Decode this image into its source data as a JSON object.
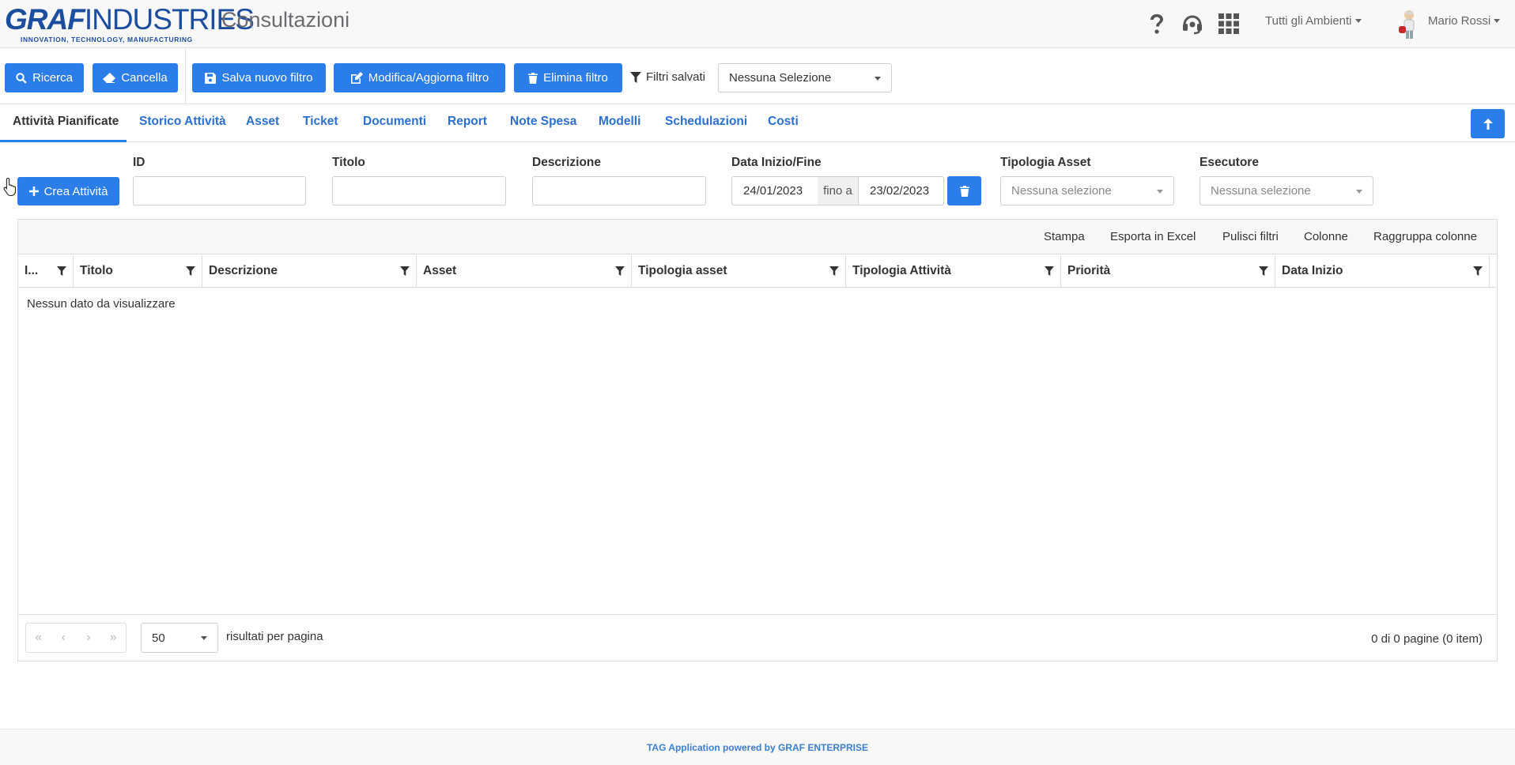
{
  "header": {
    "logo_bold": "GRAF",
    "logo_light": "INDUSTRIES",
    "logo_tagline": "INNOVATION, TECHNOLOGY, MANUFACTURING",
    "title": "Consultazioni",
    "environments_label": "Tutti gli Ambienti",
    "user_name": "Mario Rossi"
  },
  "toolbar": {
    "search_label": "Ricerca",
    "clear_label": "Cancella",
    "save_filter_label": "Salva nuovo filtro",
    "edit_filter_label": "Modifica/Aggiorna filtro",
    "delete_filter_label": "Elimina filtro",
    "saved_filters_label": "Filtri salvati",
    "saved_filters_value": "Nessuna Selezione"
  },
  "tabs": [
    {
      "label": "Attività Pianificate",
      "active": true
    },
    {
      "label": "Storico Attività"
    },
    {
      "label": "Asset"
    },
    {
      "label": "Ticket"
    },
    {
      "label": "Documenti"
    },
    {
      "label": "Report"
    },
    {
      "label": "Note Spesa"
    },
    {
      "label": "Modelli"
    },
    {
      "label": "Schedulazioni"
    },
    {
      "label": "Costi"
    }
  ],
  "filters": {
    "create_label": "Crea Attività",
    "id_label": "ID",
    "title_label": "Titolo",
    "description_label": "Descrizione",
    "date_label": "Data Inizio/Fine",
    "date_from": "24/01/2023",
    "date_sep": "fino a",
    "date_to": "23/02/2023",
    "asset_type_label": "Tipologia Asset",
    "asset_type_value": "Nessuna selezione",
    "executor_label": "Esecutore",
    "executor_value": "Nessuna selezione"
  },
  "grid": {
    "toolbar": [
      "Stampa",
      "Esporta in Excel",
      "Pulisci filtri",
      "Colonne",
      "Raggruppa colonne"
    ],
    "columns": [
      "I...",
      "Titolo",
      "Descrizione",
      "Asset",
      "Tipologia asset",
      "Tipologia Attività",
      "Priorità",
      "Data Inizio"
    ],
    "empty_message": "Nessun dato da visualizzare",
    "page_size": "50",
    "per_page_label": "risultati per pagina",
    "page_info": "0 di 0 pagine (0 item)"
  },
  "footer": {
    "text": "TAG Application powered by GRAF ENTERPRISE"
  },
  "colors": {
    "primary": "#2b7de9",
    "brand": "#1c4ea0",
    "tab_link": "#2b6fd0"
  }
}
